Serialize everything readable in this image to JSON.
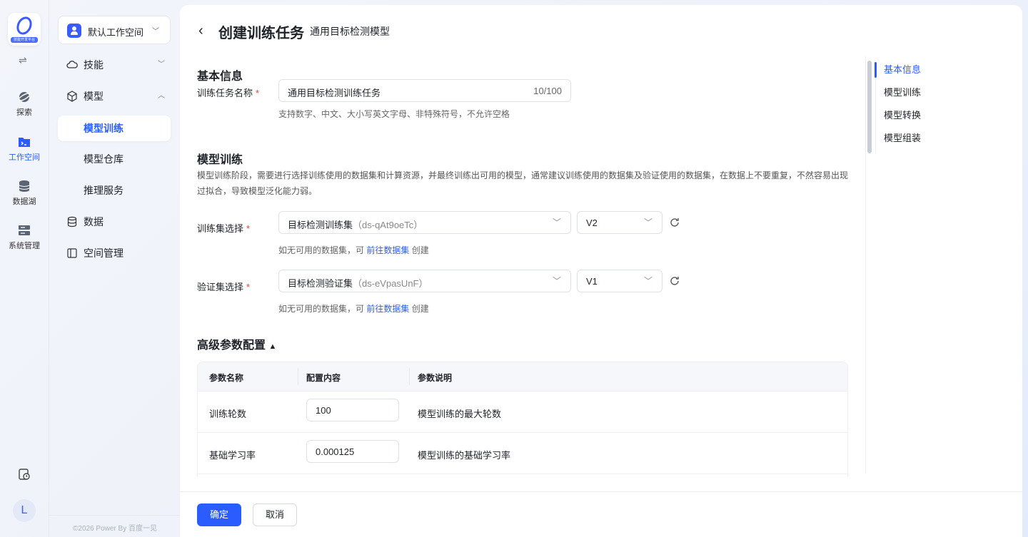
{
  "rail": {
    "logo_caption": "技能开发平台",
    "items": [
      {
        "label": "探索",
        "icon": "planet-icon"
      },
      {
        "label": "工作空间",
        "icon": "folder-terminal-icon",
        "active": true
      },
      {
        "label": "数据湖",
        "icon": "database-icon"
      },
      {
        "label": "系统管理",
        "icon": "server-icon"
      }
    ],
    "avatar": "L"
  },
  "sidebar": {
    "workspace": "默认工作空间",
    "items": [
      {
        "label": "技能"
      },
      {
        "label": "模型"
      },
      {
        "label": "模型训练",
        "active": true
      },
      {
        "label": "模型仓库"
      },
      {
        "label": "推理服务"
      },
      {
        "label": "数据"
      },
      {
        "label": "空间管理"
      }
    ],
    "copyright": "©2026 Power By 百度一见"
  },
  "header": {
    "title": "创建训练任务",
    "subtitle": "通用目标检测模型"
  },
  "basic": {
    "heading": "基本信息",
    "name_label": "训练任务名称",
    "name_value": "通用目标检测训练任务",
    "name_count": "10/100",
    "name_hint": "支持数字、中文、大小写英文字母、非特殊符号，不允许空格"
  },
  "training": {
    "heading": "模型训练",
    "desc": "模型训练阶段，需要进行选择训练使用的数据集和计算资源，并最终训练出可用的模型，通常建议训练使用的数据集及验证使用的数据集，在数据上不要重复，不然容易出现过拟合，导致模型泛化能力弱。",
    "train_label": "训练集选择",
    "train_name": "目标检测训练集",
    "train_id": "（ds-qAt9oeTc）",
    "train_version": "V2",
    "val_label": "验证集选择",
    "val_name": "目标检测验证集",
    "val_id": "（ds-eVpasUnF）",
    "val_version": "V1",
    "hint_prefix": "如无可用的数据集，可",
    "hint_link": "前往数据集",
    "hint_suffix": "创建"
  },
  "advanced": {
    "heading": "高级参数配置",
    "columns": [
      "参数名称",
      "配置内容",
      "参数说明"
    ],
    "rows": [
      {
        "name": "训练轮数",
        "value": "100",
        "desc": "模型训练的最大轮数"
      },
      {
        "name": "基础学习率",
        "value": "0.000125",
        "desc": "模型训练的基础学习率"
      }
    ]
  },
  "anchor": [
    "基本信息",
    "模型训练",
    "模型转换",
    "模型组装"
  ],
  "footer": {
    "confirm": "确定",
    "cancel": "取消"
  },
  "colors": {
    "accent": "#2b5cff",
    "required": "#f23c3c"
  }
}
